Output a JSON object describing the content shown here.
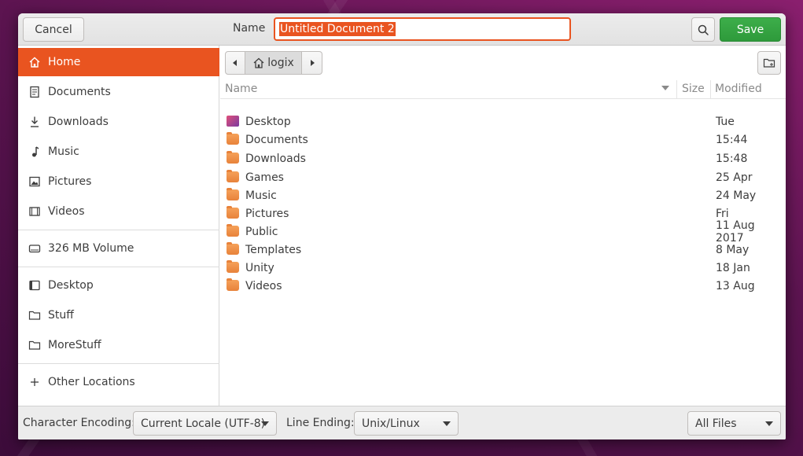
{
  "header": {
    "cancel_label": "Cancel",
    "name_label": "Name",
    "name_value": "Untitled Document 2",
    "save_label": "Save"
  },
  "sidebar": {
    "items": [
      {
        "label": "Home",
        "icon": "home-icon",
        "active": true
      },
      {
        "label": "Documents",
        "icon": "document-icon"
      },
      {
        "label": "Downloads",
        "icon": "download-icon"
      },
      {
        "label": "Music",
        "icon": "music-icon"
      },
      {
        "label": "Pictures",
        "icon": "picture-icon"
      },
      {
        "label": "Videos",
        "icon": "video-icon"
      },
      {
        "label": "326 MB Volume",
        "icon": "drive-icon"
      },
      {
        "label": "Desktop",
        "icon": "desktop-icon"
      },
      {
        "label": "Stuff",
        "icon": "folder-icon"
      },
      {
        "label": "MoreStuff",
        "icon": "folder-icon"
      },
      {
        "label": "Other Locations",
        "icon": "plus-icon"
      }
    ]
  },
  "pathbar": {
    "current": "logix"
  },
  "file_list": {
    "columns": [
      "Name",
      "Size",
      "Modified"
    ],
    "rows": [
      {
        "name": "Desktop",
        "modified": "Tue"
      },
      {
        "name": "Documents",
        "modified": "15:44"
      },
      {
        "name": "Downloads",
        "modified": "15:48"
      },
      {
        "name": "Games",
        "modified": "25 Apr"
      },
      {
        "name": "Music",
        "modified": "24 May"
      },
      {
        "name": "Pictures",
        "modified": "Fri"
      },
      {
        "name": "Public",
        "modified": "11 Aug 2017"
      },
      {
        "name": "Templates",
        "modified": "8 May"
      },
      {
        "name": "Unity",
        "modified": "18 Jan"
      },
      {
        "name": "Videos",
        "modified": "13 Aug"
      }
    ]
  },
  "bottom": {
    "encoding_label": "Character Encoding:",
    "encoding_value": "Current Locale (UTF-8)",
    "line_ending_label": "Line Ending:",
    "line_ending_value": "Unix/Linux",
    "filter_value": "All Files"
  },
  "colors": {
    "accent": "#e95420",
    "save": "#2e9a3b"
  }
}
